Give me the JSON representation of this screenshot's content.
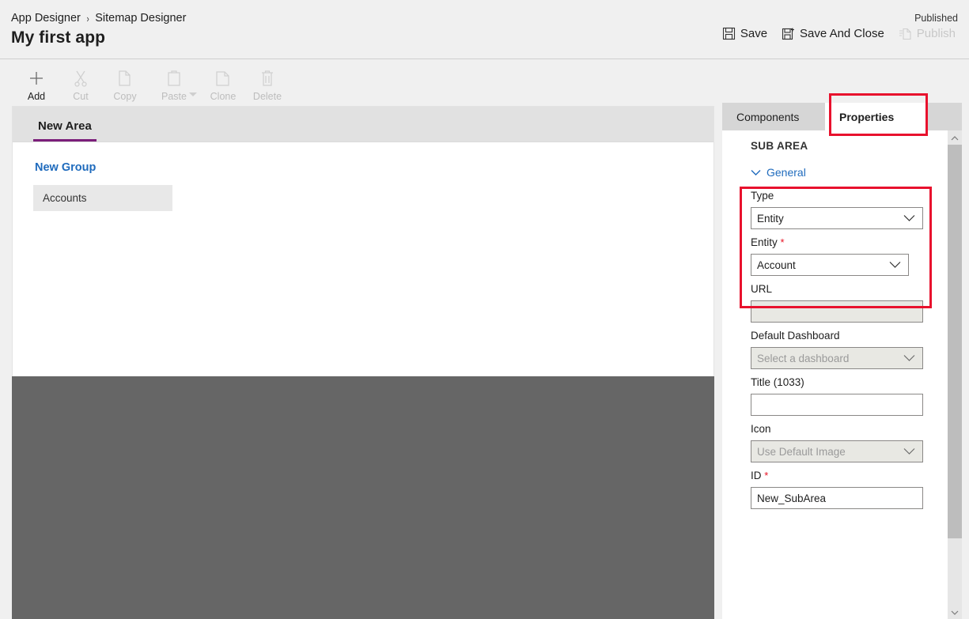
{
  "header": {
    "breadcrumb": [
      {
        "label": "App Designer"
      },
      {
        "label": "Sitemap Designer"
      }
    ],
    "separator": "›",
    "app_title": "My first app",
    "published_status": "Published",
    "commands": [
      {
        "name": "save",
        "label": "Save",
        "icon": "save-icon",
        "disabled": false
      },
      {
        "name": "save-and-close",
        "label": "Save And Close",
        "icon": "save-close-icon",
        "disabled": false
      },
      {
        "name": "publish",
        "label": "Publish",
        "icon": "publish-icon",
        "disabled": true
      }
    ]
  },
  "toolbar": {
    "items": [
      {
        "name": "add",
        "label": "Add",
        "icon": "plus-icon",
        "disabled": false,
        "caret": false
      },
      {
        "name": "cut",
        "label": "Cut",
        "icon": "scissors-icon",
        "disabled": true,
        "caret": false
      },
      {
        "name": "copy",
        "label": "Copy",
        "icon": "copy-icon",
        "disabled": true,
        "caret": false
      },
      {
        "name": "paste",
        "label": "Paste",
        "icon": "clipboard-icon",
        "disabled": true,
        "caret": true
      },
      {
        "name": "clone",
        "label": "Clone",
        "icon": "clone-icon",
        "disabled": true,
        "caret": false
      },
      {
        "name": "delete",
        "label": "Delete",
        "icon": "trash-icon",
        "disabled": true,
        "caret": false
      }
    ]
  },
  "canvas": {
    "area_tab": "New Area",
    "group_title": "New Group",
    "subarea_label": "Accounts"
  },
  "panel": {
    "tabs": [
      {
        "name": "components",
        "label": "Components",
        "active": false
      },
      {
        "name": "properties",
        "label": "Properties",
        "active": true
      }
    ],
    "section_header": "SUB AREA",
    "section_toggle": "General",
    "fields": {
      "type": {
        "label": "Type",
        "value": "Entity",
        "control": "dropdown",
        "required": false,
        "disabled": false
      },
      "entity": {
        "label": "Entity",
        "value": "Account",
        "control": "dropdown",
        "required": true,
        "required_mark": "*",
        "disabled": false
      },
      "url": {
        "label": "URL",
        "value": "",
        "placeholder": "",
        "control": "text",
        "required": false,
        "disabled": true
      },
      "default_dashboard": {
        "label": "Default Dashboard",
        "value": "Select a dashboard",
        "control": "dropdown",
        "required": false,
        "disabled": true
      },
      "title": {
        "label": "Title (1033)",
        "value": "",
        "placeholder": "",
        "control": "text",
        "required": false,
        "disabled": false
      },
      "icon": {
        "label": "Icon",
        "value": "Use Default Image",
        "control": "dropdown",
        "required": false,
        "disabled": true
      },
      "id": {
        "label": "ID",
        "value": "New_SubArea",
        "control": "text",
        "required": true,
        "required_mark": "*",
        "disabled": false
      }
    }
  },
  "annotations": [
    {
      "name": "properties-tab-highlight",
      "color": "#e8112d"
    },
    {
      "name": "type-entity-highlight",
      "color": "#e8112d"
    }
  ],
  "scrollbar": {
    "up_icon": "chevron-up-icon",
    "down_icon": "chevron-down-icon"
  },
  "colors": {
    "accent_purple": "#7b1e7a",
    "link_blue": "#1f6bbd",
    "annotation_red": "#e8112d",
    "required_red": "#e81123",
    "canvas_dark": "#666666"
  }
}
